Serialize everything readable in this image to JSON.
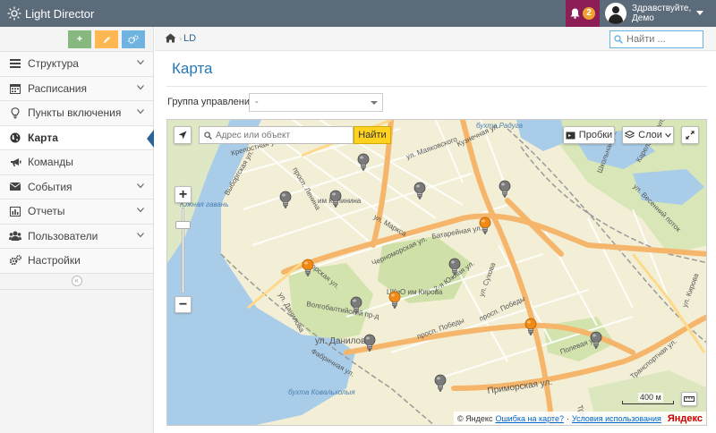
{
  "app": {
    "title": "Light Director"
  },
  "header": {
    "notifications_count": "2",
    "user_greeting_line1": "Здравствуйте,",
    "user_greeting_line2": "Демо"
  },
  "sidebar": {
    "items": [
      {
        "label": "Структура",
        "icon": "sitemap-icon",
        "chevron": true
      },
      {
        "label": "Расписания",
        "icon": "calendar-icon",
        "chevron": true
      },
      {
        "label": "Пункты включения",
        "icon": "lightbulb-icon",
        "chevron": true
      },
      {
        "label": "Карта",
        "icon": "globe-icon",
        "chevron": false
      },
      {
        "label": "Команды",
        "icon": "bullhorn-icon",
        "chevron": false
      },
      {
        "label": "События",
        "icon": "envelope-icon",
        "chevron": true
      },
      {
        "label": "Отчеты",
        "icon": "bar-chart-icon",
        "chevron": true
      },
      {
        "label": "Пользователи",
        "icon": "users-icon",
        "chevron": true
      },
      {
        "label": "Настройки",
        "icon": "cogs-icon",
        "chevron": false
      }
    ],
    "shortcut_colors": [
      "#87b87f",
      "#ffb752",
      "#6fb3e0"
    ]
  },
  "breadcrumb": {
    "current": "LD"
  },
  "search": {
    "placeholder": "Найти ..."
  },
  "page": {
    "title": "Карта",
    "group_label": "Группа управления",
    "group_value": "-"
  },
  "map": {
    "search_placeholder": "Адрес или объект",
    "find_button": "Найти",
    "traffic_button": "Пробки",
    "layers_button": "Слои",
    "scale_label": "400 м",
    "attribution_prefix": "© Яндекс",
    "attribution_error": "Ошибка на карте?",
    "attribution_terms": "Условия использования",
    "attribution_brand": "Яндекс",
    "labels": {
      "bay": "бухта Радуга",
      "bay2": "бухта Ковальхолыя",
      "harbor": "Южная гавань",
      "park": "ЦКиО им Кирова",
      "park2": "им Калинина",
      "st_mayakovsky": "ул. Маяковского",
      "st_kuznechnaya": "Кузнечная ул.",
      "st_lenina": "просп. Ленина",
      "st_vyborgskaya": "Выборгская ул.",
      "st_krepostnaya": "Крепостная ул.",
      "st_marx": "ул. Маркса",
      "st_batareinaya": "Батарейная ул.",
      "st_chernomorskaya": "Черноморская ул.",
      "st_danilova": "ул. Данилова",
      "st_danilova2": "ул. Данилова",
      "st_pobedy": "просп. Победы",
      "st_pobedy2": "просп. Победы",
      "st_primorskaya": "Приморская ул.",
      "st_sukhova": "ул. Сухова",
      "st_yuzhnaya": "2-я Южная ул.",
      "st_volgobalt": "Волгобалтийский пр-д",
      "st_fabrichnaya": "Фабричная ул.",
      "st_polevaya": "Полевая ул.",
      "st_vesenniy": "ул. Весенний поток",
      "st_karelskaya": "Карельская ул.",
      "st_transport": "Транспортная ул.",
      "st_kirova": "ул. Кирова",
      "st_travnaya": "Травная ул.",
      "st_shkolnaya": "Школьная ул.",
      "st_morskaya": "Морская ул."
    }
  }
}
